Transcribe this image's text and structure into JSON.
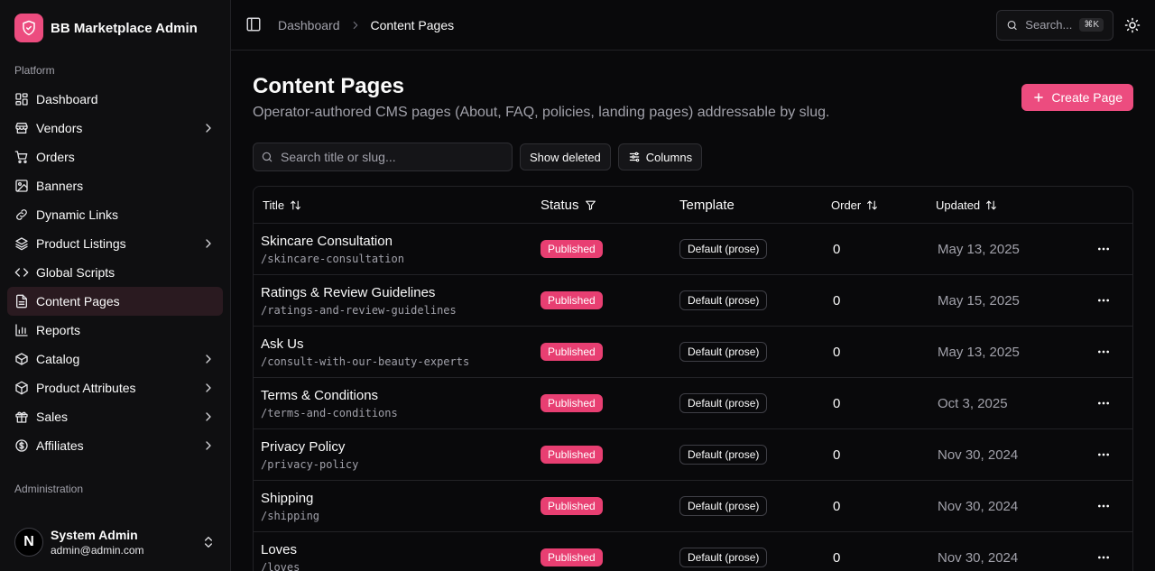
{
  "brand": {
    "name": "BB Marketplace Admin",
    "accent": "#ec4c7f"
  },
  "sidebar": {
    "platform_label": "Platform",
    "admin_label": "Administration",
    "items": [
      {
        "label": "Dashboard",
        "icon": "dashboard-icon",
        "chevron": false,
        "active": false
      },
      {
        "label": "Vendors",
        "icon": "store-icon",
        "chevron": true,
        "active": false
      },
      {
        "label": "Orders",
        "icon": "cart-icon",
        "chevron": false,
        "active": false
      },
      {
        "label": "Banners",
        "icon": "image-icon",
        "chevron": false,
        "active": false
      },
      {
        "label": "Dynamic Links",
        "icon": "link-icon",
        "chevron": false,
        "active": false
      },
      {
        "label": "Product Listings",
        "icon": "layers-icon",
        "chevron": true,
        "active": false
      },
      {
        "label": "Global Scripts",
        "icon": "code-icon",
        "chevron": false,
        "active": false
      },
      {
        "label": "Content Pages",
        "icon": "file-icon",
        "chevron": false,
        "active": true
      },
      {
        "label": "Reports",
        "icon": "chart-icon",
        "chevron": false,
        "active": false
      },
      {
        "label": "Catalog",
        "icon": "box-icon",
        "chevron": true,
        "active": false
      },
      {
        "label": "Product Attributes",
        "icon": "cube-icon",
        "chevron": true,
        "active": false
      },
      {
        "label": "Sales",
        "icon": "gift-icon",
        "chevron": true,
        "active": false
      },
      {
        "label": "Affiliates",
        "icon": "dollar-icon",
        "chevron": true,
        "active": false
      }
    ],
    "user": {
      "initial": "N",
      "name": "System Admin",
      "email": "admin@admin.com"
    }
  },
  "topbar": {
    "breadcrumb": [
      "Dashboard",
      "Content Pages"
    ],
    "search_label": "Search...",
    "search_kbd": "⌘K"
  },
  "page": {
    "title": "Content Pages",
    "subtitle": "Operator-authored CMS pages (About, FAQ, policies, landing pages) addressable by slug.",
    "create_label": "Create Page",
    "filter_placeholder": "Search title or slug...",
    "show_deleted_label": "Show deleted",
    "columns_label": "Columns"
  },
  "table": {
    "headers": {
      "title": "Title",
      "status": "Status",
      "template": "Template",
      "order": "Order",
      "updated": "Updated"
    },
    "rows": [
      {
        "title": "Skincare Consultation",
        "slug": "/skincare-consultation",
        "status": "Published",
        "template": "Default (prose)",
        "order": "0",
        "updated": "May 13, 2025"
      },
      {
        "title": "Ratings & Review Guidelines",
        "slug": "/ratings-and-review-guidelines",
        "status": "Published",
        "template": "Default (prose)",
        "order": "0",
        "updated": "May 15, 2025"
      },
      {
        "title": "Ask Us",
        "slug": "/consult-with-our-beauty-experts",
        "status": "Published",
        "template": "Default (prose)",
        "order": "0",
        "updated": "May 13, 2025"
      },
      {
        "title": "Terms & Conditions",
        "slug": "/terms-and-conditions",
        "status": "Published",
        "template": "Default (prose)",
        "order": "0",
        "updated": "Oct 3, 2025"
      },
      {
        "title": "Privacy Policy",
        "slug": "/privacy-policy",
        "status": "Published",
        "template": "Default (prose)",
        "order": "0",
        "updated": "Nov 30, 2024"
      },
      {
        "title": "Shipping",
        "slug": "/shipping",
        "status": "Published",
        "template": "Default (prose)",
        "order": "0",
        "updated": "Nov 30, 2024"
      },
      {
        "title": "Loves",
        "slug": "/loves",
        "status": "Published",
        "template": "Default (prose)",
        "order": "0",
        "updated": "Nov 30, 2024"
      }
    ]
  }
}
